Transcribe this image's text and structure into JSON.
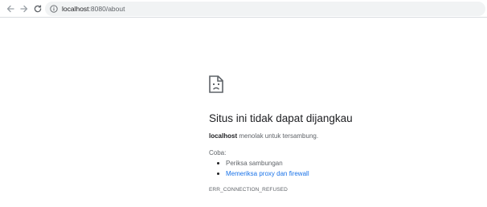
{
  "browser": {
    "url_host": "localhost",
    "url_rest": ":8080/about"
  },
  "error": {
    "title": "Situs ini tidak dapat dijangkau",
    "host": "localhost",
    "description": " menolak untuk tersambung.",
    "try_label": "Coba:",
    "suggestions": [
      {
        "text": "Periksa sambungan"
      },
      {
        "text": "Memeriksa proxy dan firewall"
      }
    ],
    "code": "ERR_CONNECTION_REFUSED"
  },
  "colors": {
    "link": "#1a73e8",
    "secondary_text": "#5f6368",
    "primary_text": "#202124",
    "omnibox_bg": "#f1f3f4"
  },
  "icons": {
    "back": "arrow-left-icon",
    "forward": "arrow-right-icon",
    "reload": "reload-icon",
    "info": "info-icon",
    "error": "sad-page-icon"
  }
}
